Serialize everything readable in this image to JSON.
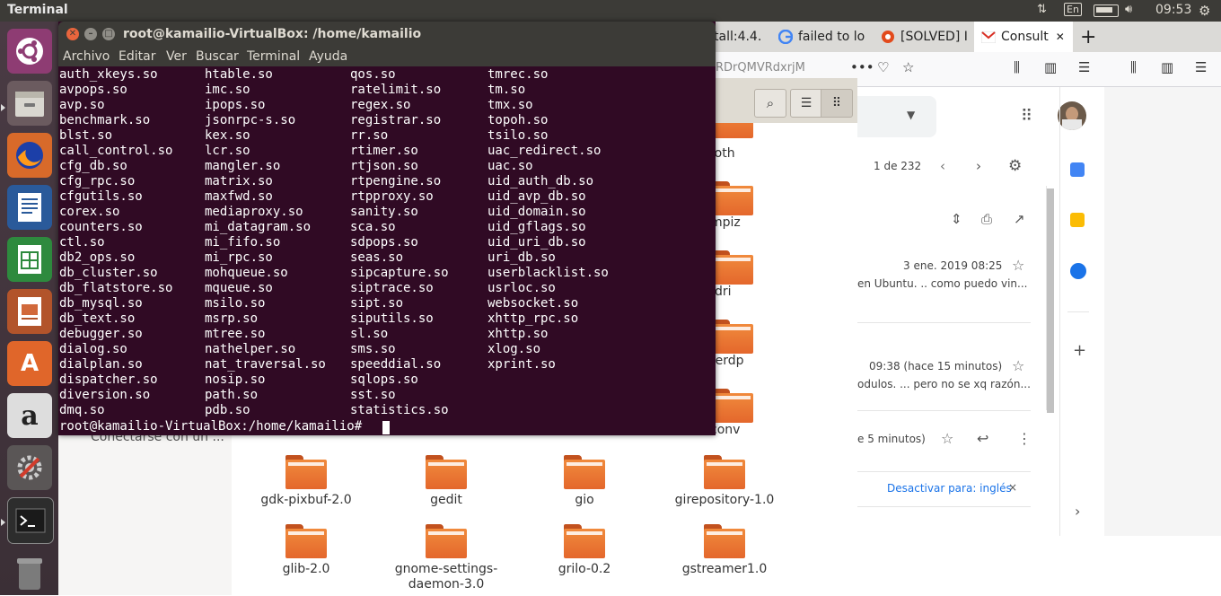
{
  "panel": {
    "title": "Terminal",
    "lang": "En",
    "clock": "09:53"
  },
  "launcher": {
    "apps": [
      "ubuntu-dash",
      "files",
      "firefox",
      "writer",
      "calc",
      "impress",
      "software-center",
      "amazon",
      "system-settings",
      "terminal",
      "trash"
    ],
    "amazon_letter": "a",
    "software_letter": "A"
  },
  "browser": {
    "tabs": [
      {
        "label": "tall:4.4."
      },
      {
        "label": "failed to lo"
      },
      {
        "label": "[SOLVED] I"
      },
      {
        "label": "Consult"
      }
    ],
    "url_fragment": "RDrQMVRdxrjM",
    "close_glyph": "✕",
    "new_tab": "+"
  },
  "gmail": {
    "pagination": "1 de 232",
    "messages": [
      {
        "date": "3 ene. 2019 08:25",
        "snippet": "en Ubuntu. .. como puedo vin..."
      },
      {
        "date": "09:38 (hace 15 minutos)",
        "snippet": "odulos. ... pero no se xq razón..."
      },
      {
        "date": "e 5 minutos)"
      }
    ],
    "translate_link": "Desactivar para: inglés",
    "translate_close": "×",
    "side_icons": [
      "calendar-icon",
      "keep-icon",
      "tasks-icon",
      "add-icon"
    ]
  },
  "nautilus": {
    "sidebar_text": "Conectarse con un ...",
    "partial_labels": [
      "etooth",
      "mpiz",
      "dri",
      "eerdp",
      "conv"
    ],
    "folders": [
      {
        "name": "gdk-pixbuf-2.0"
      },
      {
        "name": "gedit"
      },
      {
        "name": "gio"
      },
      {
        "name": "girepository-1.0"
      },
      {
        "name": "glib-2.0"
      },
      {
        "name": "gnome-settings-daemon-3.0"
      },
      {
        "name": "grilo-0.2"
      },
      {
        "name": "gstreamer1.0"
      }
    ]
  },
  "terminal": {
    "title": "root@kamailio-VirtualBox: /home/kamailio",
    "menu": [
      "Archivo",
      "Editar",
      "Ver",
      "Buscar",
      "Terminal",
      "Ayuda"
    ],
    "columns": [
      [
        "auth_xkeys.so",
        "avpops.so",
        "avp.so",
        "benchmark.so",
        "blst.so",
        "call_control.so",
        "cfg_db.so",
        "cfg_rpc.so",
        "cfgutils.so",
        "corex.so",
        "counters.so",
        "ctl.so",
        "db2_ops.so",
        "db_cluster.so",
        "db_flatstore.so",
        "db_mysql.so",
        "db_text.so",
        "debugger.so",
        "dialog.so",
        "dialplan.so",
        "dispatcher.so",
        "diversion.so",
        "dmq.so"
      ],
      [
        "htable.so",
        "imc.so",
        "ipops.so",
        "jsonrpc-s.so",
        "kex.so",
        "lcr.so",
        "mangler.so",
        "matrix.so",
        "maxfwd.so",
        "mediaproxy.so",
        "mi_datagram.so",
        "mi_fifo.so",
        "mi_rpc.so",
        "mohqueue.so",
        "mqueue.so",
        "msilo.so",
        "msrp.so",
        "mtree.so",
        "nathelper.so",
        "nat_traversal.so",
        "nosip.so",
        "path.so",
        "pdb.so"
      ],
      [
        "qos.so",
        "ratelimit.so",
        "regex.so",
        "registrar.so",
        "rr.so",
        "rtimer.so",
        "rtjson.so",
        "rtpengine.so",
        "rtpproxy.so",
        "sanity.so",
        "sca.so",
        "sdpops.so",
        "seas.so",
        "sipcapture.so",
        "siptrace.so",
        "sipt.so",
        "siputils.so",
        "sl.so",
        "sms.so",
        "speeddial.so",
        "sqlops.so",
        "sst.so",
        "statistics.so"
      ],
      [
        "tmrec.so",
        "tm.so",
        "tmx.so",
        "topoh.so",
        "tsilo.so",
        "uac_redirect.so",
        "uac.so",
        "uid_auth_db.so",
        "uid_avp_db.so",
        "uid_domain.so",
        "uid_gflags.so",
        "uid_uri_db.so",
        "uri_db.so",
        "userblacklist.so",
        "usrloc.so",
        "websocket.so",
        "xhttp_rpc.so",
        "xhttp.so",
        "xlog.so",
        "xprint.so"
      ]
    ],
    "prompt": "root@kamailio-VirtualBox:/home/kamailio#"
  }
}
